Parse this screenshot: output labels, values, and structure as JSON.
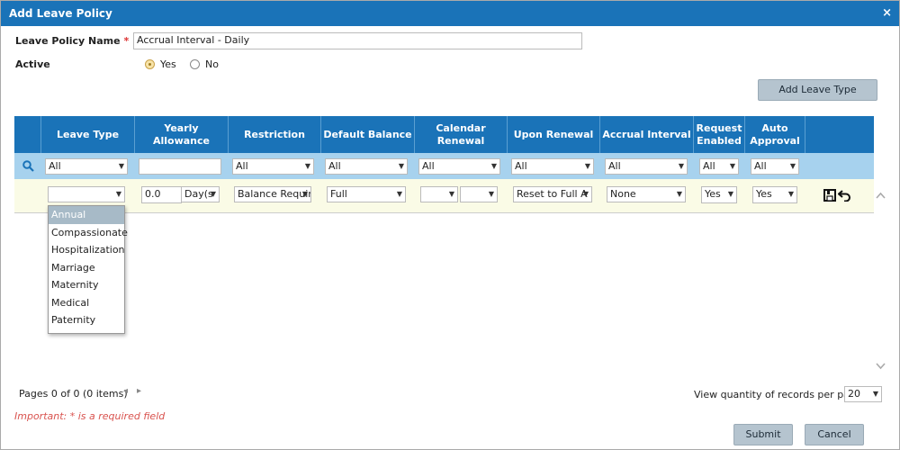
{
  "dialog": {
    "title": "Add Leave Policy",
    "close_glyph": "×"
  },
  "form": {
    "policy_name_label": "Leave Policy Name",
    "required_marker": "*",
    "policy_name_value": "Accrual Interval - Daily",
    "active_label": "Active",
    "active_yes": "Yes",
    "active_no": "No",
    "active_selected": "Yes"
  },
  "toolbar": {
    "add_leave_type": "Add Leave Type"
  },
  "grid": {
    "headers": [
      "Leave Type",
      "Yearly Allowance",
      "Restriction",
      "Default Balance",
      "Calendar Renewal",
      "Upon Renewal",
      "Accrual Interval",
      "Request Enabled",
      "Auto Approval"
    ],
    "filters": {
      "leave_type": "All",
      "yearly_allowance": "",
      "restriction": "All",
      "default_balance": "All",
      "calendar_renewal": "All",
      "upon_renewal": "All",
      "accrual_interval": "All",
      "request_enabled": "All",
      "auto_approval": "All"
    },
    "edit": {
      "leave_type": "",
      "allowance_value": "0.0",
      "allowance_unit": "Day(s",
      "restriction": "Balance Requir",
      "default_balance": "Full",
      "calendar_renewal_1": "",
      "calendar_renewal_2": "",
      "upon_renewal": "Reset to Full A",
      "accrual_interval": "None",
      "request_enabled": "Yes",
      "auto_approval": "Yes"
    },
    "leave_type_options": [
      "Annual",
      "Compassionate",
      "Hospitalization",
      "Marriage",
      "Maternity",
      "Medical",
      "Paternity"
    ],
    "leave_type_highlighted": "Annual"
  },
  "pager": {
    "summary": "Pages 0 of 0 (0 items)",
    "prev_glyph": "◂",
    "next_glyph": "▸",
    "per_page_label": "View quantity of records per page",
    "per_page_value": "20"
  },
  "footer": {
    "required_note": "Important: * is a required field",
    "submit": "Submit",
    "cancel": "Cancel"
  },
  "colors": {
    "titlebar": "#1a73b8",
    "header": "#1a73b8",
    "filter_row": "#a7d2ee",
    "edit_row": "#fafbe6",
    "button": "#b5c4cf",
    "required_note": "#d9534f"
  }
}
